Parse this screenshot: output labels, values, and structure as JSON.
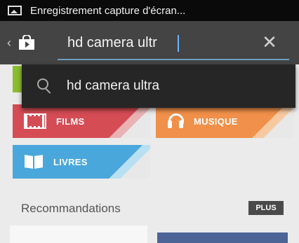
{
  "status_bar": {
    "notification_icon": "screenshot-icon",
    "text": "Enregistrement capture d'écran..."
  },
  "action_bar": {
    "up_icon": "chevron-left-icon",
    "app_icon": "play-store-bag-icon",
    "search_value": "hd camera ultr",
    "clear_icon": "close-icon",
    "accent_color": "#6b9dc2"
  },
  "suggestions": [
    {
      "icon": "search-icon",
      "text": "hd camera ultra"
    }
  ],
  "categories": [
    {
      "label": "",
      "color": "#8bbd2f"
    },
    {
      "label": "FILMS",
      "icon": "film-icon",
      "color": "#d54c55"
    },
    {
      "label": "MUSIQUE",
      "icon": "headphones-icon",
      "color": "#f0904a"
    },
    {
      "label": "LIVRES",
      "icon": "book-icon",
      "color": "#49a7dc"
    }
  ],
  "recommendations": {
    "title": "Recommandations",
    "more_label": "PLUS"
  }
}
